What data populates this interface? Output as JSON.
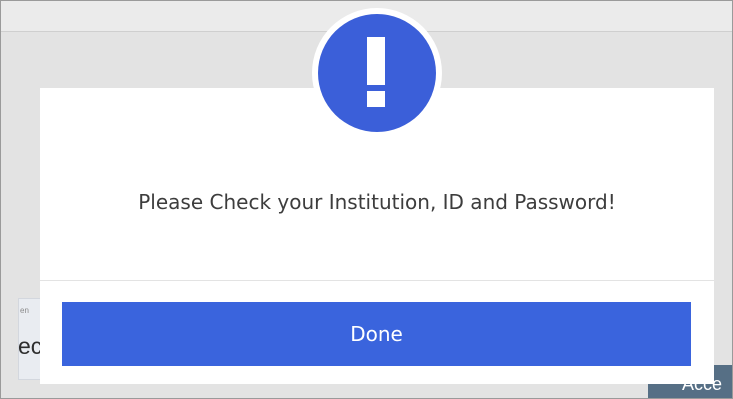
{
  "background": {
    "field_tiny_text": "en",
    "field_partial_text": "ec",
    "accept_button_partial": "Acce"
  },
  "modal": {
    "icon": "exclamation-icon",
    "message": "Please Check your Institution, ID and Password!",
    "done_label": "Done"
  },
  "colors": {
    "accent": "#3a64dd",
    "icon_blue": "#3b5fd9",
    "background_button": "#566f85"
  }
}
